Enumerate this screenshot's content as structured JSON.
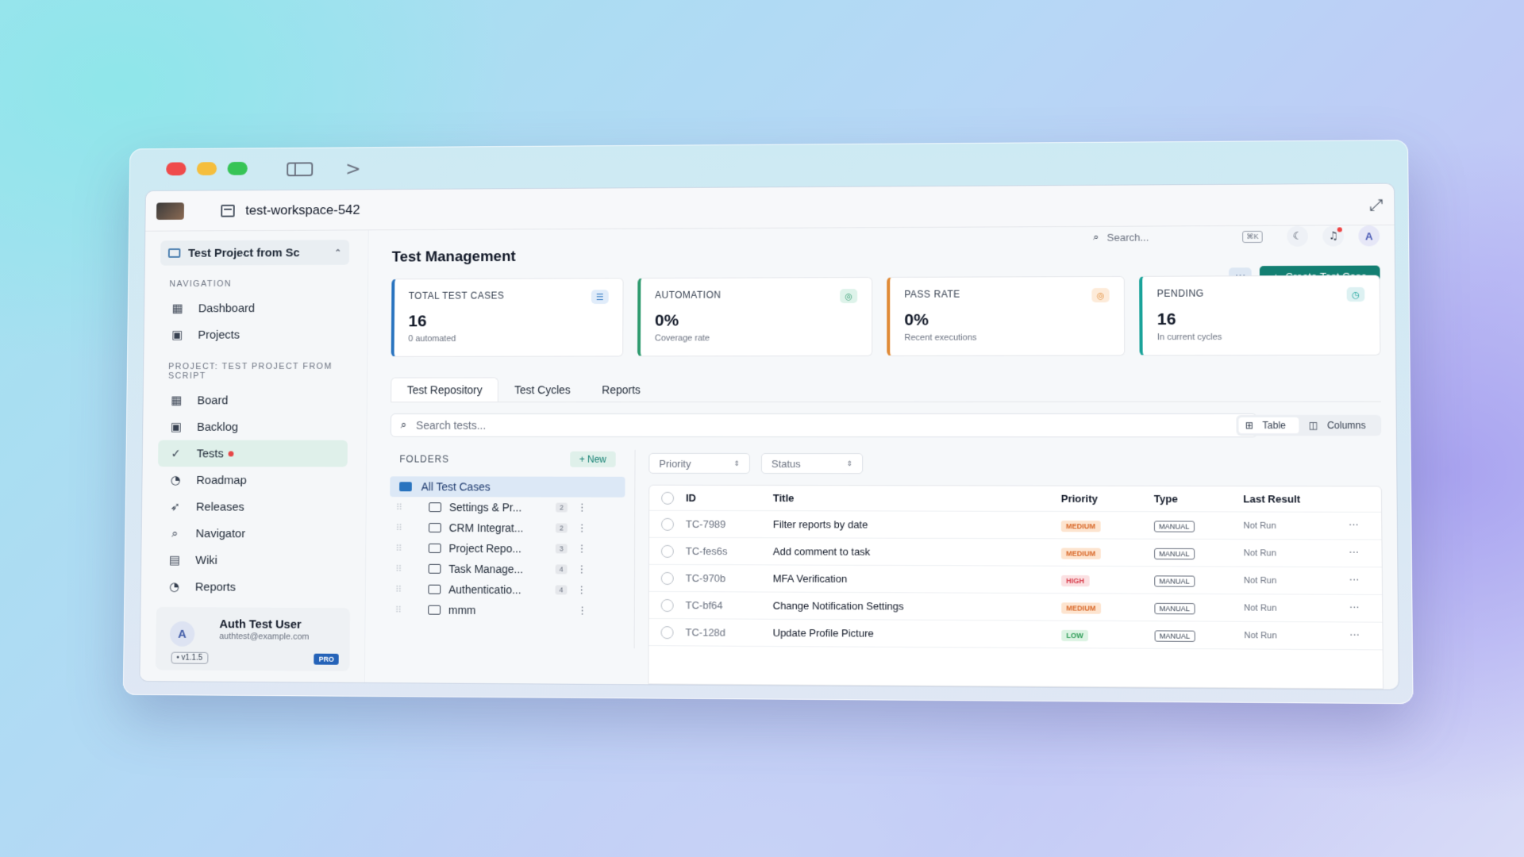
{
  "workspace": {
    "name": "test-workspace-542"
  },
  "sidebar": {
    "project_selector": "Test Project from Sc",
    "nav_heading": "NAVIGATION",
    "nav_items": [
      {
        "label": "Dashboard",
        "icon": "grid-icon"
      },
      {
        "label": "Projects",
        "icon": "briefcase-icon"
      }
    ],
    "project_heading": "PROJECT: TEST PROJECT FROM SCRIPT",
    "project_items": [
      {
        "label": "Board",
        "icon": "grid-icon"
      },
      {
        "label": "Backlog",
        "icon": "briefcase-icon"
      },
      {
        "label": "Tests",
        "icon": "check-circle-icon",
        "active": true
      },
      {
        "label": "Roadmap",
        "icon": "pie-icon"
      },
      {
        "label": "Releases",
        "icon": "rocket-icon"
      },
      {
        "label": "Navigator",
        "icon": "search-icon"
      },
      {
        "label": "Wiki",
        "icon": "book-icon"
      },
      {
        "label": "Reports",
        "icon": "chart-icon"
      }
    ],
    "user": {
      "initial": "A",
      "name": "Auth Test User",
      "email": "authtest@example.com",
      "version": "• v1.1.5",
      "plan": "PRO"
    }
  },
  "header": {
    "search_placeholder": "Search...",
    "search_shortcut": "⌘K",
    "avatar_initial": "A"
  },
  "main": {
    "title": "Test Management",
    "more_label": "···",
    "create_button": "Create Test Case",
    "stats": [
      {
        "label": "TOTAL TEST CASES",
        "value": "16",
        "sub": "0 automated",
        "color": "#2a74bf"
      },
      {
        "label": "AUTOMATION",
        "value": "0%",
        "sub": "Coverage rate",
        "color": "#2e9a6e"
      },
      {
        "label": "PASS RATE",
        "value": "0%",
        "sub": "Recent executions",
        "color": "#e08a36"
      },
      {
        "label": "PENDING",
        "value": "16",
        "sub": "In current cycles",
        "color": "#1aa39a"
      }
    ],
    "tabs": [
      "Test Repository",
      "Test Cycles",
      "Reports"
    ],
    "search_tests_placeholder": "Search tests...",
    "view_toggle": [
      "Table",
      "Columns"
    ],
    "folders": {
      "heading": "FOLDERS",
      "new_label": "New",
      "all_label": "All Test Cases",
      "items": [
        {
          "name": "Settings & Pr...",
          "count": "2"
        },
        {
          "name": "CRM Integrat...",
          "count": "2"
        },
        {
          "name": "Project Repo...",
          "count": "3"
        },
        {
          "name": "Task Manage...",
          "count": "4"
        },
        {
          "name": "Authenticatio...",
          "count": "4"
        },
        {
          "name": "mmm",
          "count": ""
        }
      ]
    },
    "filters": [
      "Priority",
      "Status"
    ],
    "table": {
      "columns": [
        "ID",
        "Title",
        "Priority",
        "Type",
        "Last Result"
      ],
      "rows": [
        {
          "id": "TC-7989",
          "title": "Filter reports by date",
          "priority": "MEDIUM",
          "type": "MANUAL",
          "result": "Not Run"
        },
        {
          "id": "TC-fes6s",
          "title": "Add comment to task",
          "priority": "MEDIUM",
          "type": "MANUAL",
          "result": "Not Run"
        },
        {
          "id": "TC-970b",
          "title": "MFA Verification",
          "priority": "HIGH",
          "type": "MANUAL",
          "result": "Not Run"
        },
        {
          "id": "TC-bf64",
          "title": "Change Notification Settings",
          "priority": "MEDIUM",
          "type": "MANUAL",
          "result": "Not Run"
        },
        {
          "id": "TC-128d",
          "title": "Update Profile Picture",
          "priority": "LOW",
          "type": "MANUAL",
          "result": "Not Run"
        }
      ]
    }
  }
}
